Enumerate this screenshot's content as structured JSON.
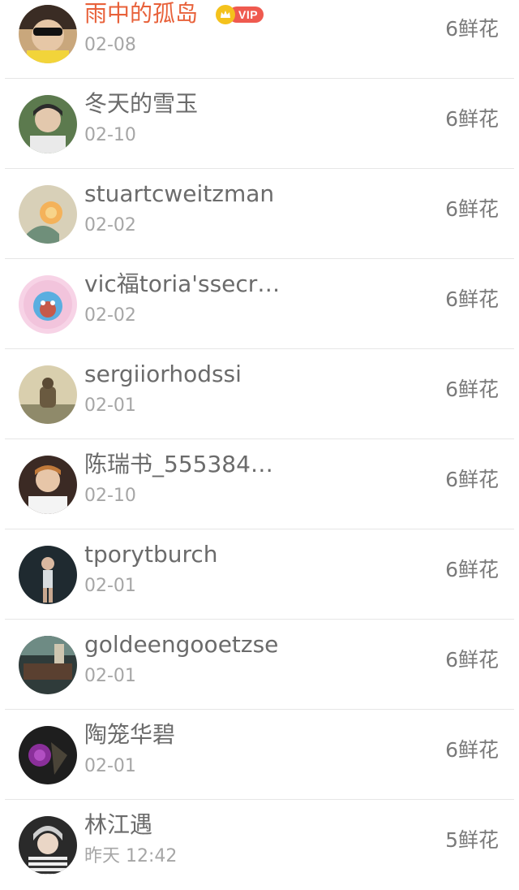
{
  "list": {
    "rows": [
      {
        "name": "雨中的孤岛",
        "time": "02-08",
        "flowers": "6鲜花",
        "vip_label": "VIP",
        "name_color": "#e8613a"
      },
      {
        "name": "冬天的雪玉",
        "time": "02-10",
        "flowers": "6鲜花"
      },
      {
        "name": "stuartcweitzman",
        "time": "02-02",
        "flowers": "6鲜花"
      },
      {
        "name": "vic福toria'ssecr…",
        "time": "02-02",
        "flowers": "6鲜花"
      },
      {
        "name": "sergiiorhodssi",
        "time": "02-01",
        "flowers": "6鲜花"
      },
      {
        "name": "陈瑞书_555384…",
        "time": "02-10",
        "flowers": "6鲜花"
      },
      {
        "name": "tporytburch",
        "time": "02-01",
        "flowers": "6鲜花"
      },
      {
        "name": "goldeengooetzse",
        "time": "02-01",
        "flowers": "6鲜花"
      },
      {
        "name": "陶笼华碧",
        "time": "02-01",
        "flowers": "6鲜花"
      },
      {
        "name": "林江遇",
        "time": "昨天 12:42",
        "flowers": "5鲜花"
      }
    ]
  },
  "colors": {
    "name_text": "#6b6b6b",
    "time_text": "#a6a6a6",
    "flower_text": "#7a7a7a",
    "vip_pill": "#ef5a4f",
    "crown": "#f4c21c",
    "divider": "#e6e6e6"
  },
  "icons": {
    "vip_crown": "crown-icon"
  }
}
